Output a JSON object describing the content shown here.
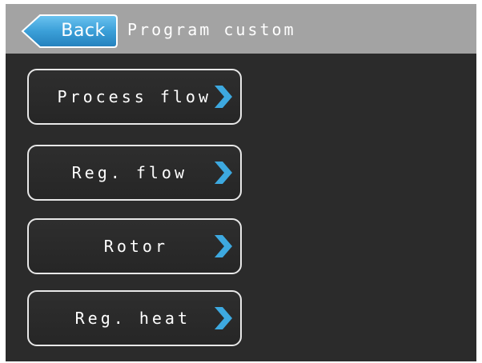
{
  "header": {
    "back_label": "Back",
    "title": "Program custom"
  },
  "menu": {
    "items": [
      {
        "label": "Process flow"
      },
      {
        "label": "Reg. flow"
      },
      {
        "label": "Rotor"
      },
      {
        "label": "Reg. heat"
      }
    ]
  },
  "colors": {
    "header_bg": "#a3a3a3",
    "screen_bg": "#2b2b2b",
    "back_button": "#3b9fd8",
    "chevron": "#3da9e0",
    "button_border": "#e8e8e8",
    "text": "#ffffff"
  },
  "icons": {
    "back": "back-arrow-icon",
    "chevron": "chevron-right-icon"
  }
}
